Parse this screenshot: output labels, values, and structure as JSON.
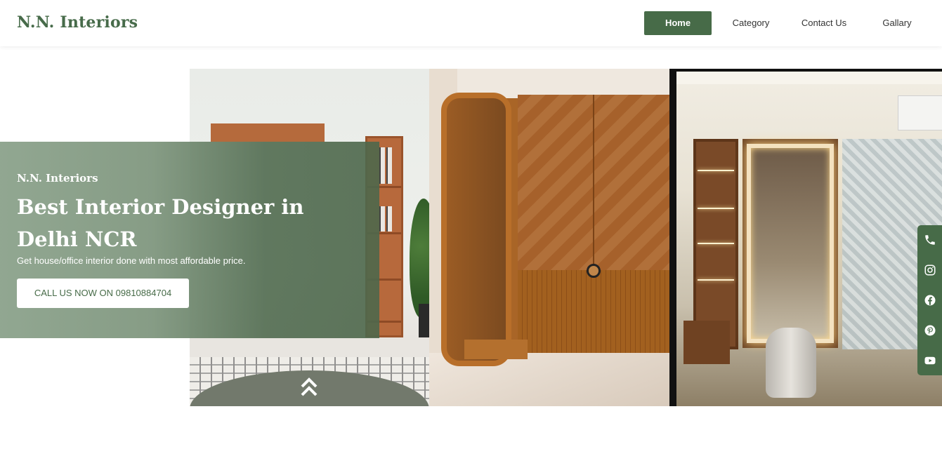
{
  "brand": "N.N. Interiors",
  "nav": [
    {
      "label": "Home",
      "active": true
    },
    {
      "label": "Category",
      "active": false
    },
    {
      "label": "Contact Us",
      "active": false
    },
    {
      "label": "Gallary",
      "active": false
    }
  ],
  "hero": {
    "brand": "N.N. Interiors",
    "title": "Best Interior Designer in Delhi NCR",
    "subtitle": "Get house/office interior done with most affordable price.",
    "cta": "CALL US NOW ON 09810884704",
    "scroll_icon": "double-chevron-up-icon"
  },
  "social": [
    "phone-icon",
    "instagram-icon",
    "facebook-icon",
    "pinterest-icon",
    "youtube-icon"
  ],
  "colors": {
    "brand_green": "#476b48",
    "white": "#ffffff"
  }
}
